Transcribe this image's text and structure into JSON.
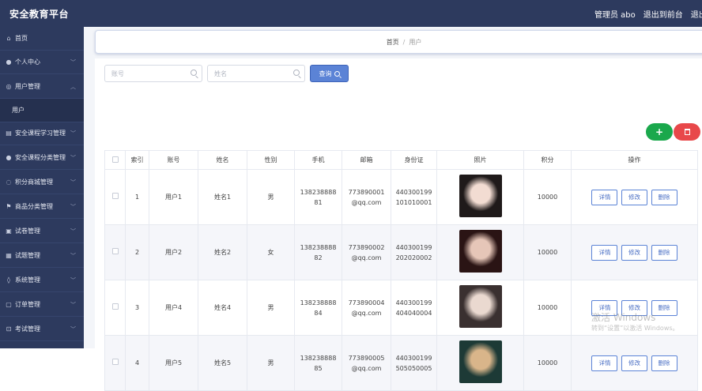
{
  "app": {
    "title": "安全教育平台"
  },
  "topbar": {
    "admin_label": "管理员 abo",
    "back_label": "退出到前台",
    "logout_label": "退出登录"
  },
  "sidebar": {
    "items": [
      {
        "label": "首页",
        "icon": "home-icon",
        "glyph": "⌂"
      },
      {
        "label": "个人中心",
        "icon": "user-icon",
        "glyph": "●"
      },
      {
        "label": "用户管理",
        "icon": "user-manage-icon",
        "glyph": "◎"
      },
      {
        "label": "用户",
        "icon": "",
        "glyph": ""
      },
      {
        "label": "安全课程学习管理",
        "icon": "book-icon",
        "glyph": "▤"
      },
      {
        "label": "安全课程分类管理",
        "icon": "category-icon",
        "glyph": "●"
      },
      {
        "label": "积分商城管理",
        "icon": "mall-icon",
        "glyph": "◌"
      },
      {
        "label": "商品分类管理",
        "icon": "flag-icon",
        "glyph": "⚑"
      },
      {
        "label": "试卷管理",
        "icon": "paper-icon",
        "glyph": "▣"
      },
      {
        "label": "试题管理",
        "icon": "question-icon",
        "glyph": "▦"
      },
      {
        "label": "系统管理",
        "icon": "settings-icon",
        "glyph": "◊"
      },
      {
        "label": "订单管理",
        "icon": "order-icon",
        "glyph": "▢"
      },
      {
        "label": "考试管理",
        "icon": "exam-icon",
        "glyph": "⊡"
      }
    ]
  },
  "breadcrumb": {
    "home": "首页",
    "separator": "/",
    "current": "用户"
  },
  "search": {
    "account_placeholder": "账号",
    "name_placeholder": "姓名",
    "query_label": "查询"
  },
  "actions": {
    "add_symbol": "+",
    "delete_icon": "trash-icon"
  },
  "table": {
    "headers": [
      "",
      "索引",
      "账号",
      "姓名",
      "性别",
      "手机",
      "邮箱",
      "身份证",
      "照片",
      "积分",
      "操作"
    ],
    "rows": [
      {
        "index": "1",
        "account": "用户1",
        "name": "姓名1",
        "gender": "男",
        "phone": "13823888881",
        "email": "773890001@qq.com",
        "id_card": "440300199101010001",
        "points": "10000",
        "photo_colors": [
          "#f2dcd2",
          "#1f1a1a"
        ]
      },
      {
        "index": "2",
        "account": "用户2",
        "name": "姓名2",
        "gender": "女",
        "phone": "13823888882",
        "email": "773890002@qq.com",
        "id_card": "440300199202020002",
        "points": "10000",
        "photo_colors": [
          "#e6c6b8",
          "#2a1414"
        ]
      },
      {
        "index": "3",
        "account": "用户4",
        "name": "姓名4",
        "gender": "男",
        "phone": "13823888884",
        "email": "773890004@qq.com",
        "id_card": "440300199404040004",
        "points": "10000",
        "photo_colors": [
          "#ead9d0",
          "#3a3030"
        ]
      },
      {
        "index": "4",
        "account": "用户5",
        "name": "姓名5",
        "gender": "男",
        "phone": "13823888885",
        "email": "773890005@qq.com",
        "id_card": "440300199505050005",
        "points": "10000",
        "photo_colors": [
          "#d9b58a",
          "#1d3a36"
        ]
      }
    ],
    "row_actions": {
      "detail": "详情",
      "edit": "修改",
      "delete": "删除"
    }
  },
  "watermark": {
    "line1": "激活 Windows",
    "line2": "转到“设置”以激活 Windows。"
  }
}
